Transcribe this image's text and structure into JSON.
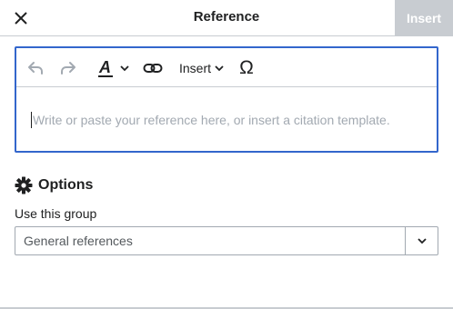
{
  "header": {
    "title": "Reference",
    "insert_label": "Insert"
  },
  "toolbar": {
    "insert_menu_label": "Insert",
    "special_character": "Ω"
  },
  "editor": {
    "placeholder": "Write or paste your reference here, or insert a citation template."
  },
  "options": {
    "heading": "Options",
    "group_label": "Use this group",
    "group_value": "General references"
  },
  "colors": {
    "accent": "#3366cc",
    "disabled_button": "#c8ccd1",
    "border": "#a2a9b1",
    "placeholder": "#a2a9b1"
  }
}
